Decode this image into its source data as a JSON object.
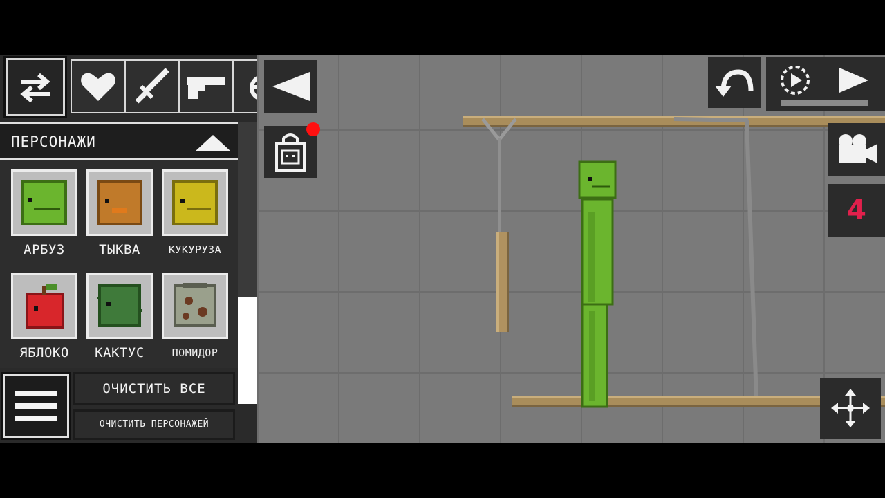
{
  "left_panel": {
    "category_tabs": [
      {
        "icon": "heart-icon"
      },
      {
        "icon": "sword-icon"
      },
      {
        "icon": "pistol-icon"
      },
      {
        "icon": "explosive-icon"
      }
    ],
    "category_title": "ПЕРСОНАЖИ",
    "items": [
      {
        "label": "АРБУЗ",
        "icon": "watermelon-head-icon",
        "color": "#6bb52e"
      },
      {
        "label": "ТЫКВА",
        "icon": "pumpkin-head-icon",
        "color": "#c07a2a"
      },
      {
        "label": "КУКУРУЗА",
        "icon": "corn-head-icon",
        "color": "#cbb81c"
      },
      {
        "label": "ЯБЛОКО",
        "icon": "apple-head-icon",
        "color": "#d8262b"
      },
      {
        "label": "КАКТУС",
        "icon": "cactus-head-icon",
        "color": "#3f7a3a"
      },
      {
        "label": "ПОМИДОР",
        "icon": "tomato-head-icon",
        "color": "#9aa08c"
      }
    ],
    "clear_all_label": "ОЧИСТИТЬ ВСЕ",
    "clear_characters_label": "ОЧИСТИТЬ ПЕРСОНАЖЕЙ"
  },
  "toolbar": {
    "collapse_icon": "triangle-left-icon",
    "shop_icon": "shop-bag-icon",
    "undo_icon": "undo-arrow-icon",
    "slowmo_icon": "slow-motion-icon",
    "play_icon": "play-icon",
    "camera_icon": "camera-icon",
    "counter_value": "4",
    "move_icon": "move-arrows-icon"
  },
  "colors": {
    "scene_bg": "#7a7a7a",
    "panel_bg": "#2a2a2a",
    "counter": "#e1204c",
    "notification": "#ff1010",
    "melon": "#6bb52e"
  }
}
